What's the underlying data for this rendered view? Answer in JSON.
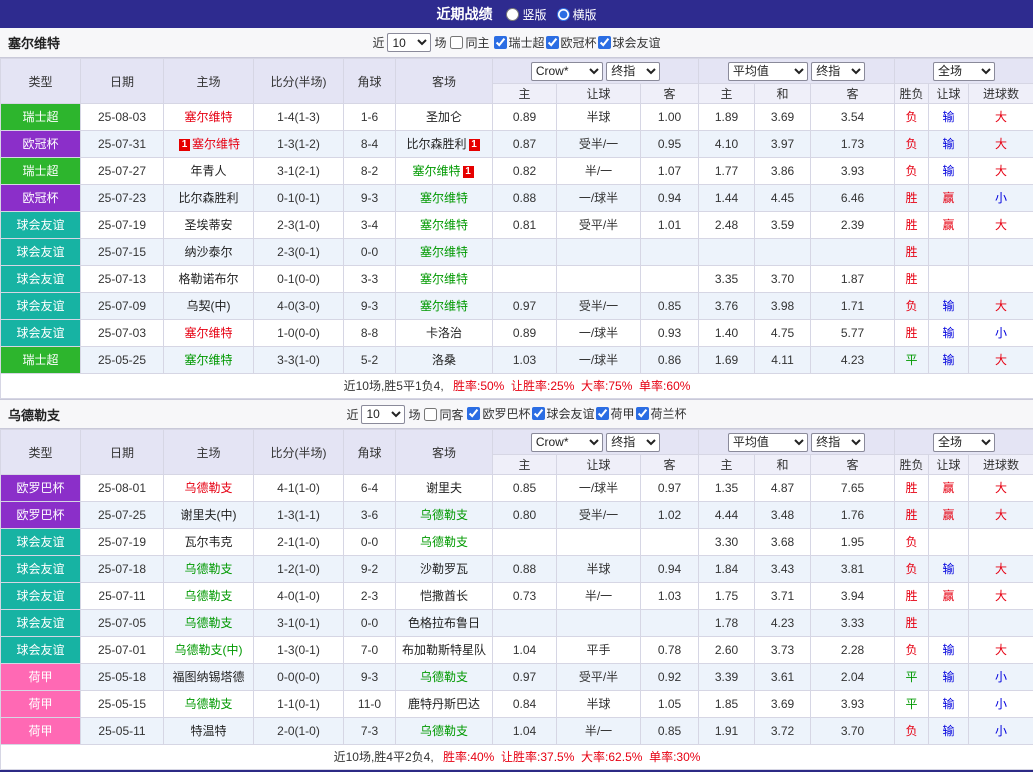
{
  "topbar": {
    "title": "近期战绩",
    "options": [
      {
        "label": "竖版",
        "selected": false
      },
      {
        "label": "横版",
        "selected": true
      }
    ]
  },
  "palette": {
    "topbar_bg": "#2e2b8f",
    "header_bg": "#e4e4f4",
    "stripe_bg": "#edf3fb",
    "text_colors": {
      "r": "#e60012",
      "g": "#009900",
      "b": "#0000dd",
      "k": "#222222"
    },
    "league_colors": {
      "瑞士超": "#2db52d",
      "欧冠杯": "#8b2fc9",
      "球会友谊": "#17b3a3",
      "欧罗巴杯": "#8b2fc9",
      "荷甲": "#ff69b4"
    }
  },
  "columns": {
    "main": [
      "类型",
      "日期",
      "主场",
      "比分(半场)",
      "角球",
      "客场"
    ],
    "crown": {
      "bookmaker": "Crow*",
      "index": "终指",
      "cols": [
        "主",
        "让球",
        "客"
      ]
    },
    "average": {
      "bookmaker": "平均值",
      "index": "终指",
      "cols": [
        "主",
        "和",
        "客"
      ]
    },
    "full": {
      "select": "全场",
      "cols": [
        "胜负",
        "让球",
        "进球数"
      ]
    }
  },
  "sections": [
    {
      "team": "塞尔维特",
      "filter": {
        "near": "近",
        "count": "10",
        "games": "场",
        "same": "同主",
        "same_checked": false,
        "leagues": [
          "瑞士超",
          "欧冠杯",
          "球会友谊"
        ]
      },
      "rows": [
        {
          "league": "瑞士超",
          "date": "25-08-03",
          "home": {
            "name": "塞尔维特",
            "color": "r"
          },
          "score": "1-4(1-3)",
          "corners": "1-6",
          "away": {
            "name": "圣加仑",
            "color": "k"
          },
          "crown": [
            "0.89",
            "半球",
            "1.00"
          ],
          "average": [
            "1.89",
            "3.69",
            "3.54"
          ],
          "results": [
            [
              "负",
              "r"
            ],
            [
              "输",
              "b"
            ],
            [
              "大",
              "r"
            ]
          ]
        },
        {
          "league": "欧冠杯",
          "date": "25-07-31",
          "home": {
            "name": "塞尔维特",
            "color": "r",
            "badge": "1",
            "badge_side": "left"
          },
          "score": "1-3(1-2)",
          "corners": "8-4",
          "away": {
            "name": "比尔森胜利",
            "color": "k",
            "badge": "1"
          },
          "crown": [
            "0.87",
            "受半/一",
            "0.95"
          ],
          "average": [
            "4.10",
            "3.97",
            "1.73"
          ],
          "results": [
            [
              "负",
              "r"
            ],
            [
              "输",
              "b"
            ],
            [
              "大",
              "r"
            ]
          ]
        },
        {
          "league": "瑞士超",
          "date": "25-07-27",
          "home": {
            "name": "年青人",
            "color": "k"
          },
          "score": "3-1(2-1)",
          "corners": "8-2",
          "away": {
            "name": "塞尔维特",
            "color": "g",
            "badge": "1"
          },
          "crown": [
            "0.82",
            "半/一",
            "1.07"
          ],
          "average": [
            "1.77",
            "3.86",
            "3.93"
          ],
          "results": [
            [
              "负",
              "r"
            ],
            [
              "输",
              "b"
            ],
            [
              "大",
              "r"
            ]
          ]
        },
        {
          "league": "欧冠杯",
          "date": "25-07-23",
          "home": {
            "name": "比尔森胜利",
            "color": "k"
          },
          "score": "0-1(0-1)",
          "corners": "9-3",
          "away": {
            "name": "塞尔维特",
            "color": "g"
          },
          "crown": [
            "0.88",
            "一/球半",
            "0.94"
          ],
          "average": [
            "1.44",
            "4.45",
            "6.46"
          ],
          "results": [
            [
              "胜",
              "r"
            ],
            [
              "赢",
              "r"
            ],
            [
              "小",
              "b"
            ]
          ]
        },
        {
          "league": "球会友谊",
          "date": "25-07-19",
          "home": {
            "name": "圣埃蒂安",
            "color": "k"
          },
          "score": "2-3(1-0)",
          "corners": "3-4",
          "away": {
            "name": "塞尔维特",
            "color": "g"
          },
          "crown": [
            "0.81",
            "受平/半",
            "1.01"
          ],
          "average": [
            "2.48",
            "3.59",
            "2.39"
          ],
          "results": [
            [
              "胜",
              "r"
            ],
            [
              "赢",
              "r"
            ],
            [
              "大",
              "r"
            ]
          ]
        },
        {
          "league": "球会友谊",
          "date": "25-07-15",
          "home": {
            "name": "纳沙泰尔",
            "color": "k"
          },
          "score": "2-3(0-1)",
          "corners": "0-0",
          "away": {
            "name": "塞尔维特",
            "color": "g"
          },
          "crown": [
            "",
            "",
            ""
          ],
          "average": [
            "",
            "",
            ""
          ],
          "results": [
            [
              "胜",
              "r"
            ],
            [
              "",
              ""
            ],
            [
              "",
              ""
            ]
          ]
        },
        {
          "league": "球会友谊",
          "date": "25-07-13",
          "home": {
            "name": "格勒诺布尔",
            "color": "k"
          },
          "score": "0-1(0-0)",
          "corners": "3-3",
          "away": {
            "name": "塞尔维特",
            "color": "g"
          },
          "crown": [
            "",
            "",
            ""
          ],
          "average": [
            "3.35",
            "3.70",
            "1.87"
          ],
          "results": [
            [
              "胜",
              "r"
            ],
            [
              "",
              ""
            ],
            [
              "",
              ""
            ]
          ]
        },
        {
          "league": "球会友谊",
          "date": "25-07-09",
          "home": {
            "name": "乌契(中)",
            "color": "k"
          },
          "score": "4-0(3-0)",
          "corners": "9-3",
          "away": {
            "name": "塞尔维特",
            "color": "g"
          },
          "crown": [
            "0.97",
            "受半/一",
            "0.85"
          ],
          "average": [
            "3.76",
            "3.98",
            "1.71"
          ],
          "results": [
            [
              "负",
              "r"
            ],
            [
              "输",
              "b"
            ],
            [
              "大",
              "r"
            ]
          ]
        },
        {
          "league": "球会友谊",
          "date": "25-07-03",
          "home": {
            "name": "塞尔维特",
            "color": "r"
          },
          "score": "1-0(0-0)",
          "corners": "8-8",
          "away": {
            "name": "卡洛治",
            "color": "k"
          },
          "crown": [
            "0.89",
            "一/球半",
            "0.93"
          ],
          "average": [
            "1.40",
            "4.75",
            "5.77"
          ],
          "results": [
            [
              "胜",
              "r"
            ],
            [
              "输",
              "b"
            ],
            [
              "小",
              "b"
            ]
          ]
        },
        {
          "league": "瑞士超",
          "date": "25-05-25",
          "home": {
            "name": "塞尔维特",
            "color": "g"
          },
          "score": "3-3(1-0)",
          "corners": "5-2",
          "away": {
            "name": "洛桑",
            "color": "k"
          },
          "crown": [
            "1.03",
            "一/球半",
            "0.86"
          ],
          "average": [
            "1.69",
            "4.11",
            "4.23"
          ],
          "results": [
            [
              "平",
              "g"
            ],
            [
              "输",
              "b"
            ],
            [
              "大",
              "r"
            ]
          ]
        }
      ],
      "footer": {
        "lead": "近10场,胜5平1负4,",
        "stats": "胜率:50%  让胜率:25%  大率:75%  单率:60%"
      }
    },
    {
      "team": "乌德勒支",
      "filter": {
        "near": "近",
        "count": "10",
        "games": "场",
        "same": "同客",
        "same_checked": false,
        "leagues": [
          "欧罗巴杯",
          "球会友谊",
          "荷甲",
          "荷兰杯"
        ]
      },
      "rows": [
        {
          "league": "欧罗巴杯",
          "date": "25-08-01",
          "home": {
            "name": "乌德勒支",
            "color": "r"
          },
          "score": "4-1(1-0)",
          "corners": "6-4",
          "away": {
            "name": "谢里夫",
            "color": "k"
          },
          "crown": [
            "0.85",
            "一/球半",
            "0.97"
          ],
          "average": [
            "1.35",
            "4.87",
            "7.65"
          ],
          "results": [
            [
              "胜",
              "r"
            ],
            [
              "赢",
              "r"
            ],
            [
              "大",
              "r"
            ]
          ]
        },
        {
          "league": "欧罗巴杯",
          "date": "25-07-25",
          "home": {
            "name": "谢里夫(中)",
            "color": "k"
          },
          "score": "1-3(1-1)",
          "corners": "3-6",
          "away": {
            "name": "乌德勒支",
            "color": "g"
          },
          "crown": [
            "0.80",
            "受半/一",
            "1.02"
          ],
          "average": [
            "4.44",
            "3.48",
            "1.76"
          ],
          "results": [
            [
              "胜",
              "r"
            ],
            [
              "赢",
              "r"
            ],
            [
              "大",
              "r"
            ]
          ]
        },
        {
          "league": "球会友谊",
          "date": "25-07-19",
          "home": {
            "name": "瓦尔韦克",
            "color": "k"
          },
          "score": "2-1(1-0)",
          "corners": "0-0",
          "away": {
            "name": "乌德勒支",
            "color": "g"
          },
          "crown": [
            "",
            "",
            ""
          ],
          "average": [
            "3.30",
            "3.68",
            "1.95"
          ],
          "results": [
            [
              "负",
              "r"
            ],
            [
              "",
              ""
            ],
            [
              "",
              ""
            ]
          ]
        },
        {
          "league": "球会友谊",
          "date": "25-07-18",
          "home": {
            "name": "乌德勒支",
            "color": "g"
          },
          "score": "1-2(1-0)",
          "corners": "9-2",
          "away": {
            "name": "沙勒罗瓦",
            "color": "k"
          },
          "crown": [
            "0.88",
            "半球",
            "0.94"
          ],
          "average": [
            "1.84",
            "3.43",
            "3.81"
          ],
          "results": [
            [
              "负",
              "r"
            ],
            [
              "输",
              "b"
            ],
            [
              "大",
              "r"
            ]
          ]
        },
        {
          "league": "球会友谊",
          "date": "25-07-11",
          "home": {
            "name": "乌德勒支",
            "color": "g"
          },
          "score": "4-0(1-0)",
          "corners": "2-3",
          "away": {
            "name": "恺撒酋长",
            "color": "k"
          },
          "crown": [
            "0.73",
            "半/一",
            "1.03"
          ],
          "average": [
            "1.75",
            "3.71",
            "3.94"
          ],
          "results": [
            [
              "胜",
              "r"
            ],
            [
              "赢",
              "r"
            ],
            [
              "大",
              "r"
            ]
          ]
        },
        {
          "league": "球会友谊",
          "date": "25-07-05",
          "home": {
            "name": "乌德勒支",
            "color": "g"
          },
          "score": "3-1(0-1)",
          "corners": "0-0",
          "away": {
            "name": "色格拉布鲁日",
            "color": "k"
          },
          "crown": [
            "",
            "",
            ""
          ],
          "average": [
            "1.78",
            "4.23",
            "3.33"
          ],
          "results": [
            [
              "胜",
              "r"
            ],
            [
              "",
              ""
            ],
            [
              "",
              ""
            ]
          ]
        },
        {
          "league": "球会友谊",
          "date": "25-07-01",
          "home": {
            "name": "乌德勒支(中)",
            "color": "g"
          },
          "score": "1-3(0-1)",
          "corners": "7-0",
          "away": {
            "name": "布加勒斯特星队",
            "color": "k"
          },
          "crown": [
            "1.04",
            "平手",
            "0.78"
          ],
          "average": [
            "2.60",
            "3.73",
            "2.28"
          ],
          "results": [
            [
              "负",
              "r"
            ],
            [
              "输",
              "b"
            ],
            [
              "大",
              "r"
            ]
          ]
        },
        {
          "league": "荷甲",
          "date": "25-05-18",
          "home": {
            "name": "福图纳锡塔德",
            "color": "k"
          },
          "score": "0-0(0-0)",
          "corners": "9-3",
          "away": {
            "name": "乌德勒支",
            "color": "g"
          },
          "crown": [
            "0.97",
            "受平/半",
            "0.92"
          ],
          "average": [
            "3.39",
            "3.61",
            "2.04"
          ],
          "results": [
            [
              "平",
              "g"
            ],
            [
              "输",
              "b"
            ],
            [
              "小",
              "b"
            ]
          ]
        },
        {
          "league": "荷甲",
          "date": "25-05-15",
          "home": {
            "name": "乌德勒支",
            "color": "g"
          },
          "score": "1-1(0-1)",
          "corners": "11-0",
          "away": {
            "name": "鹿特丹斯巴达",
            "color": "k"
          },
          "crown": [
            "0.84",
            "半球",
            "1.05"
          ],
          "average": [
            "1.85",
            "3.69",
            "3.93"
          ],
          "results": [
            [
              "平",
              "g"
            ],
            [
              "输",
              "b"
            ],
            [
              "小",
              "b"
            ]
          ]
        },
        {
          "league": "荷甲",
          "date": "25-05-11",
          "home": {
            "name": "特温特",
            "color": "k"
          },
          "score": "2-0(1-0)",
          "corners": "7-3",
          "away": {
            "name": "乌德勒支",
            "color": "g"
          },
          "crown": [
            "1.04",
            "半/一",
            "0.85"
          ],
          "average": [
            "1.91",
            "3.72",
            "3.70"
          ],
          "results": [
            [
              "负",
              "r"
            ],
            [
              "输",
              "b"
            ],
            [
              "小",
              "b"
            ]
          ]
        }
      ],
      "footer": {
        "lead": "近10场,胜4平2负4,",
        "stats": "胜率:40%  让胜率:37.5%  大率:62.5%  单率:30%"
      }
    }
  ]
}
